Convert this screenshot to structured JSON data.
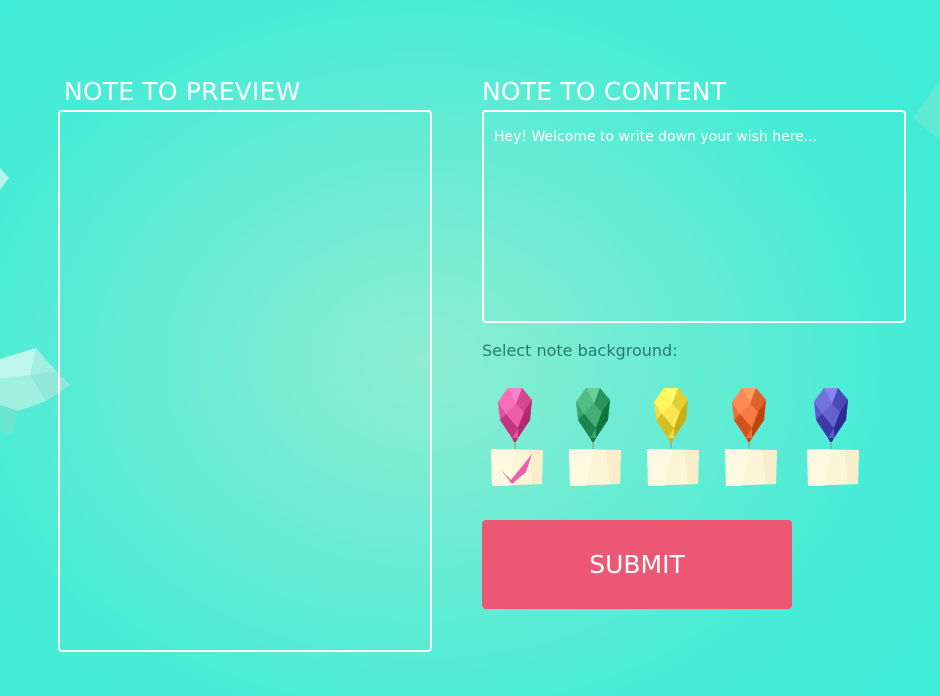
{
  "preview": {
    "title": "NOTE TO PREVIEW"
  },
  "content": {
    "title": "NOTE TO CONTENT",
    "placeholder": "Hey! Welcome to write down your wish here..."
  },
  "background_selector": {
    "label": "Select note background:",
    "options": [
      {
        "name": "pink",
        "color": "#e0559e",
        "selected": true
      },
      {
        "name": "green",
        "color": "#3aa36b",
        "selected": false
      },
      {
        "name": "yellow",
        "color": "#f2dd45",
        "selected": false
      },
      {
        "name": "orange",
        "color": "#f0703a",
        "selected": false
      },
      {
        "name": "blue",
        "color": "#5a58c4",
        "selected": false
      }
    ],
    "selected_icon": "checkmark-icon"
  },
  "submit": {
    "label": "SUBMIT"
  },
  "colors": {
    "accent": "#ec5874",
    "background": "#45ecd6",
    "label_text": "#2a7a6a",
    "note_paper": "#fdf6d6"
  }
}
